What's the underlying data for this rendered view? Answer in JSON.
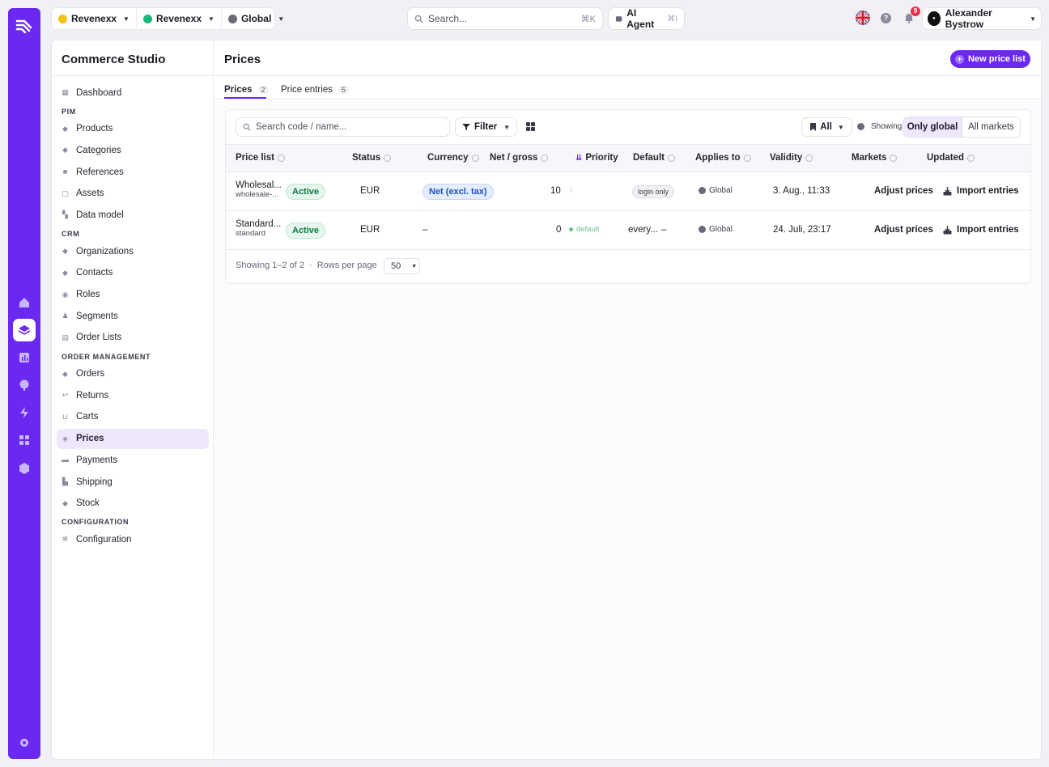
{
  "topbar": {
    "org_label": "Revenexx",
    "account_label": "Revenexx",
    "market_label": "Global",
    "search": {
      "placeholder": "Search...",
      "shortcut": "⌘K"
    },
    "ai_agent": {
      "label": "AI Agent",
      "shortcut": "⌘I"
    },
    "notifications_count": "9",
    "user_name": "Alexander Bystrow",
    "help_label": "?"
  },
  "sidebar": {
    "title": "Commerce Studio",
    "items": {
      "dashboard": "Dashboard",
      "pim_header": "PIM",
      "products": "Products",
      "categories": "Categories",
      "references": "References",
      "assets": "Assets",
      "data_model": "Data model",
      "crm_header": "CRM",
      "organizations": "Organizations",
      "contacts": "Contacts",
      "roles": "Roles",
      "segments": "Segments",
      "order_lists": "Order Lists",
      "om_header": "ORDER MANAGEMENT",
      "orders": "Orders",
      "returns": "Returns",
      "carts": "Carts",
      "prices": "Prices",
      "payments": "Payments",
      "shipping": "Shipping",
      "stock": "Stock",
      "config_header": "CONFIGURATION",
      "configuration": "Configuration"
    }
  },
  "page": {
    "title": "Prices",
    "new_button": "New price list",
    "tabs": [
      {
        "label": "Prices",
        "count": "2"
      },
      {
        "label": "Price entries",
        "count": "5"
      }
    ]
  },
  "toolbar": {
    "search_placeholder": "Search code / name...",
    "filter_label": "Filter",
    "all_label": "All",
    "showing_label": "Showing",
    "only_global": "Only global",
    "all_markets": "All markets"
  },
  "table": {
    "headers": {
      "price_list": "Price list",
      "status": "Status",
      "currency": "Currency",
      "net_gross": "Net / gross",
      "priority": "Priority",
      "default": "Default",
      "applies_to": "Applies to",
      "validity": "Validity",
      "markets": "Markets",
      "updated": "Updated"
    },
    "rows": [
      {
        "name": "Wholesal...",
        "code": "wholesale-...",
        "status": "Active",
        "currency": "EUR",
        "net_gross": "Net (excl. tax)",
        "priority": "10",
        "default": "login only",
        "applies_to": "Global",
        "validity": "3. Aug., 11:33",
        "action1": "Adjust prices",
        "action2": "Import entries"
      },
      {
        "name": "Standard...",
        "code": "standard",
        "status": "Active",
        "currency": "EUR",
        "net_gross": "–",
        "priority": "0",
        "default_tag": "default",
        "default": "every...",
        "default_dash": "–",
        "applies_to": "Global",
        "validity": "24. Juli, 23:17",
        "action1": "Adjust prices",
        "action2": "Import entries"
      }
    ]
  },
  "footer": {
    "showing": "Showing 1–2 of 2",
    "separator": "·",
    "rows_per_page_label": "Rows per page",
    "rows_per_page_value": "50"
  },
  "colors": {
    "accent": "#6a28f0",
    "active_green": "#0c7a43",
    "net_blue": "#1d4fc4",
    "notification_red": "#e8324b"
  }
}
